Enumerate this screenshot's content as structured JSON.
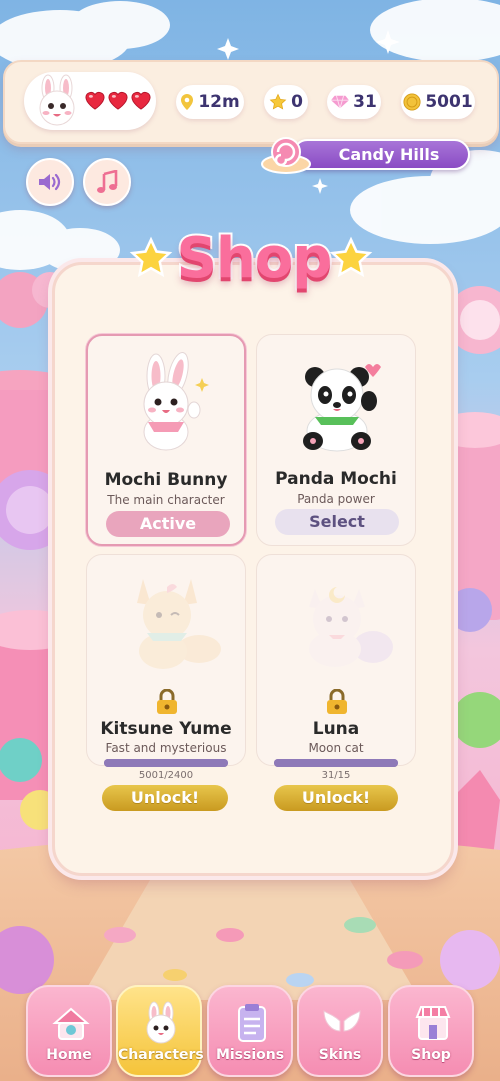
{
  "hud": {
    "hearts": 3,
    "distance": "12m",
    "stars": "0",
    "gems": "31",
    "coins": "5001",
    "world": "Candy Hills"
  },
  "colors": {
    "accent_pink": "#fa6e9c",
    "world_purple": "#8a4cc4",
    "unlock_gold": "#d4aa2c",
    "active_pink": "#e9a5bd"
  },
  "shop": {
    "title": "Shop",
    "characters": [
      {
        "name": "Mochi Bunny",
        "desc": "The main character",
        "button": "Active",
        "state": "active",
        "icon": "bunny"
      },
      {
        "name": "Panda Mochi",
        "desc": "Panda power",
        "button": "Select",
        "state": "owned",
        "icon": "panda"
      },
      {
        "name": "Kitsune Yume",
        "desc": "Fast and mysterious",
        "button": "Unlock!",
        "state": "locked",
        "progress": "5001/2400",
        "progress_fraction": 1.0,
        "icon": "fox"
      },
      {
        "name": "Luna",
        "desc": "Moon cat",
        "button": "Unlock!",
        "state": "locked",
        "progress": "31/15",
        "progress_fraction": 1.0,
        "icon": "cat"
      }
    ]
  },
  "nav": {
    "items": [
      {
        "label": "Home",
        "icon": "house-icon"
      },
      {
        "label": "Characters",
        "icon": "bunny-icon",
        "selected": true
      },
      {
        "label": "Missions",
        "icon": "clipboard-icon"
      },
      {
        "label": "Skins",
        "icon": "wings-icon"
      },
      {
        "label": "Shop",
        "icon": "store-icon"
      }
    ]
  }
}
